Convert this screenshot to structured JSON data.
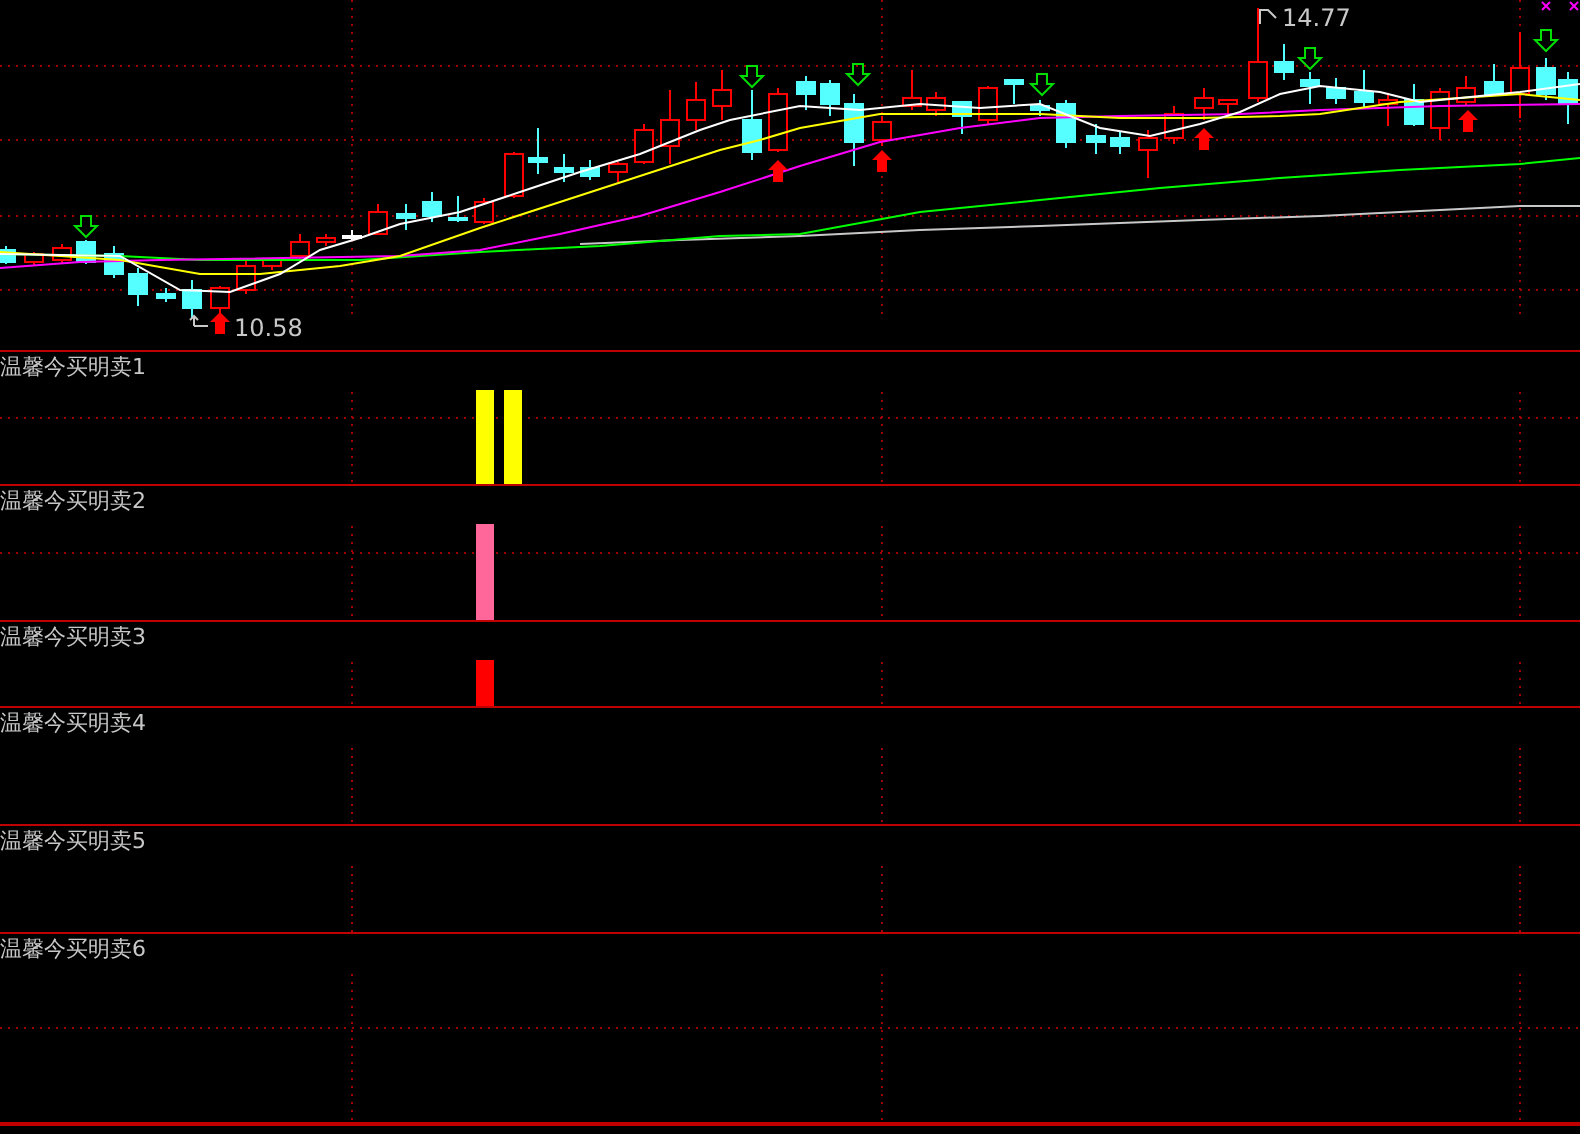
{
  "main_chart": {
    "high_label": "14.77",
    "low_label": "10.58"
  },
  "panels": [
    {
      "title": "温馨今买明卖1",
      "signals": [
        {
          "color": "#ffff00"
        },
        {
          "color": "#ffff00"
        }
      ]
    },
    {
      "title": "温馨今买明卖2",
      "signals": [
        {
          "color": "#ff6699"
        }
      ]
    },
    {
      "title": "温馨今买明卖3",
      "signals": [
        {
          "color": "#ff0000"
        }
      ]
    },
    {
      "title": "温馨今买明卖4"
    },
    {
      "title": "温馨今买明卖5"
    },
    {
      "title": "温馨今买明卖6"
    }
  ]
}
